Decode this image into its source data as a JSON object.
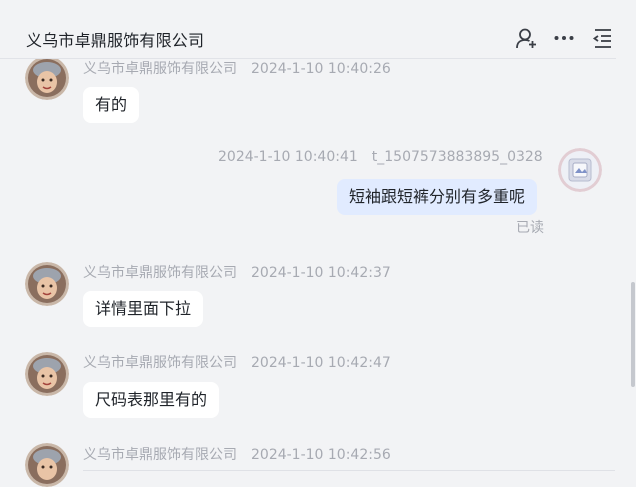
{
  "header": {
    "title": "义乌市卓鼎服饰有限公司",
    "icons": [
      "add-user-icon",
      "more-icon",
      "menu-collapse-icon"
    ]
  },
  "messages": [
    {
      "sender": "义乌市卓鼎服饰有限公司",
      "time": "2024-1-10 10:40:26",
      "text": "有的",
      "side": "left"
    },
    {
      "sender": "t_1507573883895_0328",
      "time": "2024-1-10 10:40:41",
      "text": "短袖跟短裤分别有多重呢",
      "side": "right",
      "status": "已读"
    },
    {
      "sender": "义乌市卓鼎服饰有限公司",
      "time": "2024-1-10 10:42:37",
      "text": "详情里面下拉",
      "side": "left"
    },
    {
      "sender": "义乌市卓鼎服饰有限公司",
      "time": "2024-1-10 10:42:47",
      "text": "尺码表那里有的",
      "side": "left"
    },
    {
      "sender": "义乌市卓鼎服饰有限公司",
      "time": "2024-1-10 10:42:56",
      "text": "",
      "side": "left"
    }
  ],
  "colors": {
    "background": "#f2f3f5",
    "bubble_received": "#ffffff",
    "bubble_sent": "#e1ebff",
    "meta_text": "#a7aab2",
    "primary_text": "#1f2329"
  }
}
